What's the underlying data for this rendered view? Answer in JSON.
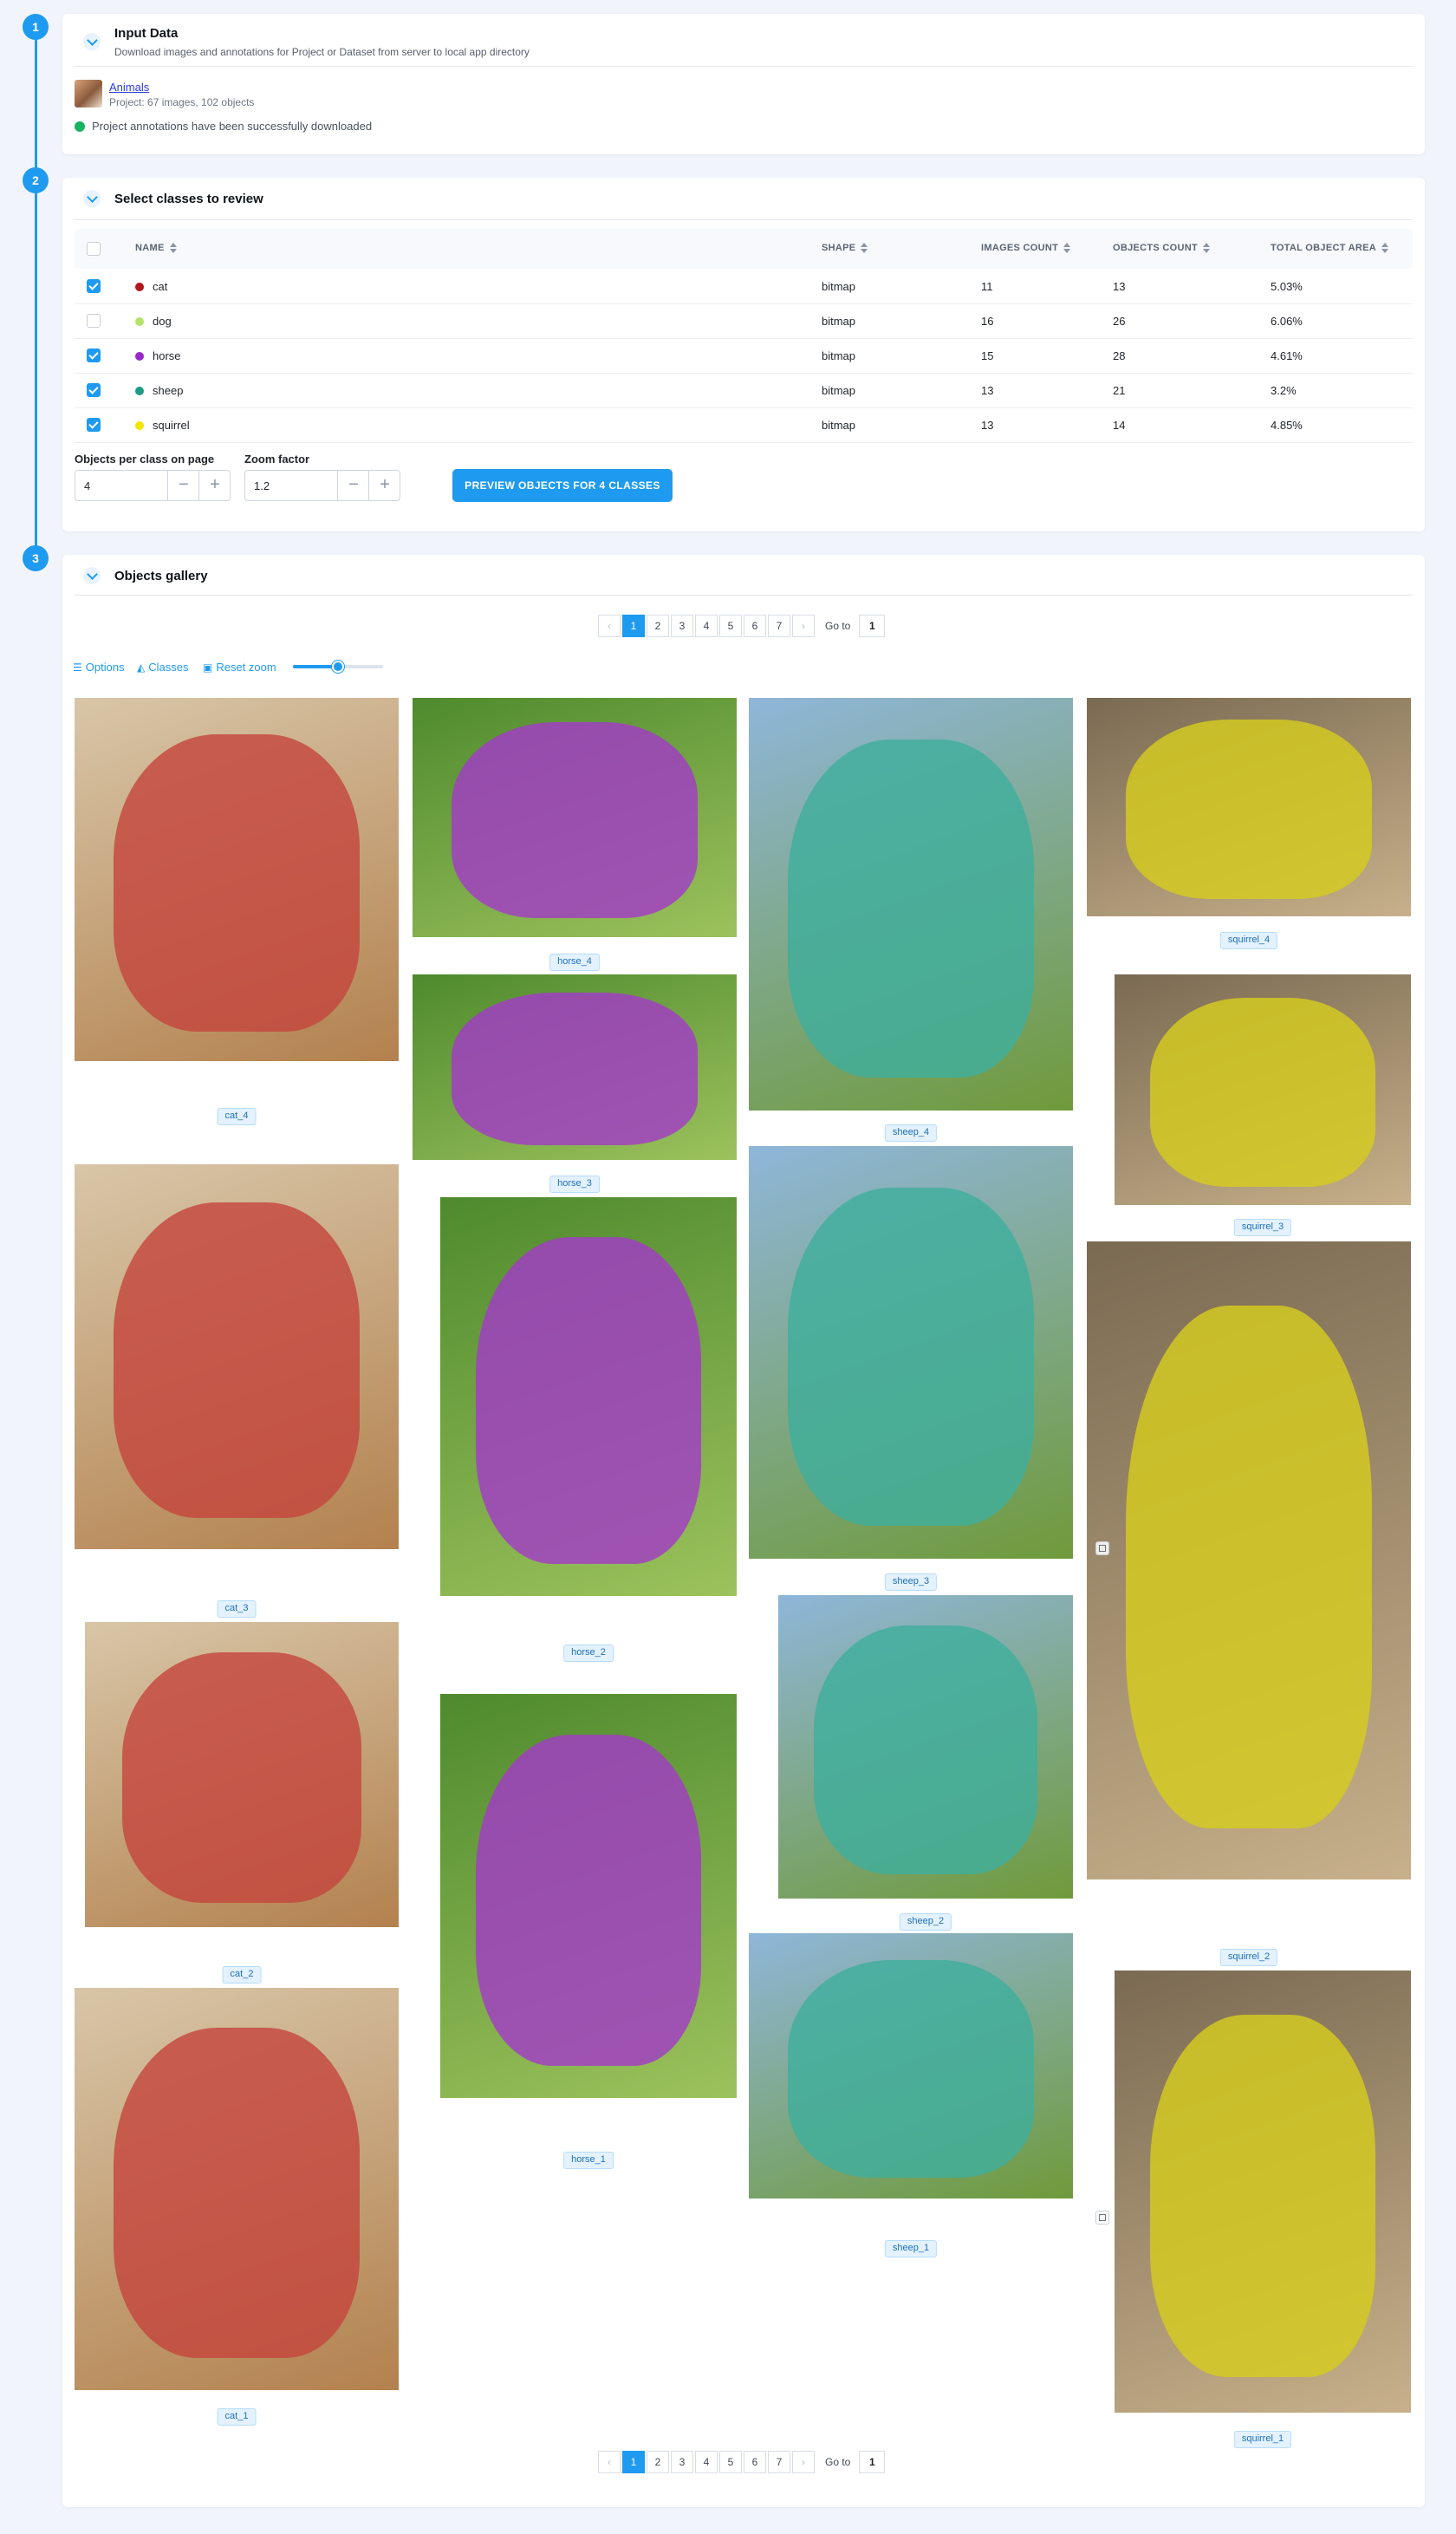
{
  "steps": [
    "1",
    "2",
    "3"
  ],
  "input_card": {
    "title": "Input Data",
    "description": "Download images and annotations for Project or Dataset from server to local app directory",
    "project_name": "Animals",
    "project_meta": "Project: 67 images, 102 objects",
    "status": "Project annotations have been successfully downloaded"
  },
  "classes_card": {
    "title": "Select classes to review",
    "columns": [
      "NAME",
      "SHAPE",
      "IMAGES COUNT",
      "OBJECTS COUNT",
      "TOTAL OBJECT AREA"
    ],
    "rows": [
      {
        "checked": true,
        "name": "cat",
        "color": "#b3151c",
        "shape": "bitmap",
        "images": "11",
        "objects": "13",
        "area": "5.03%"
      },
      {
        "checked": false,
        "name": "dog",
        "color": "#b5e468",
        "shape": "bitmap",
        "images": "16",
        "objects": "26",
        "area": "6.06%"
      },
      {
        "checked": true,
        "name": "horse",
        "color": "#9b27c9",
        "shape": "bitmap",
        "images": "15",
        "objects": "28",
        "area": "4.61%"
      },
      {
        "checked": true,
        "name": "sheep",
        "color": "#1d9a85",
        "shape": "bitmap",
        "images": "13",
        "objects": "21",
        "area": "3.2%"
      },
      {
        "checked": true,
        "name": "squirrel",
        "color": "#f2e600",
        "shape": "bitmap",
        "images": "13",
        "objects": "14",
        "area": "4.85%"
      }
    ],
    "objects_per_page_label": "Objects per class on page",
    "objects_per_page_value": "4",
    "zoom_label": "Zoom factor",
    "zoom_value": "1.2",
    "minus": "−",
    "plus": "+",
    "preview_button": "PREVIEW OBJECTS FOR 4 CLASSES"
  },
  "gallery_card": {
    "title": "Objects gallery",
    "pages": [
      "1",
      "2",
      "3",
      "4",
      "5",
      "6",
      "7"
    ],
    "active_page": "1",
    "goto_label": "Go to",
    "goto_value": "1",
    "prev_icon": "‹",
    "next_icon": "›",
    "options_label": "Options",
    "classes_label": "Classes",
    "reset_zoom_label": "Reset zoom",
    "zoom_slider_level": 0.5,
    "captions": {
      "cat_4": "cat_4",
      "cat_3": "cat_3",
      "cat_2": "cat_2",
      "cat_1": "cat_1",
      "horse_4": "horse_4",
      "horse_3": "horse_3",
      "horse_2": "horse_2",
      "horse_1": "horse_1",
      "sheep_4": "sheep_4",
      "sheep_3": "sheep_3",
      "sheep_2": "sheep_2",
      "sheep_1": "sheep_1",
      "squirrel_4": "squirrel_4",
      "squirrel_3": "squirrel_3",
      "squirrel_2": "squirrel_2",
      "squirrel_1": "squirrel_1"
    },
    "mask_colors": {
      "cat": "#c4473e",
      "horse": "#a23cc6",
      "sheep": "#3fae9c",
      "squirrel": "#d6cc1e"
    }
  }
}
